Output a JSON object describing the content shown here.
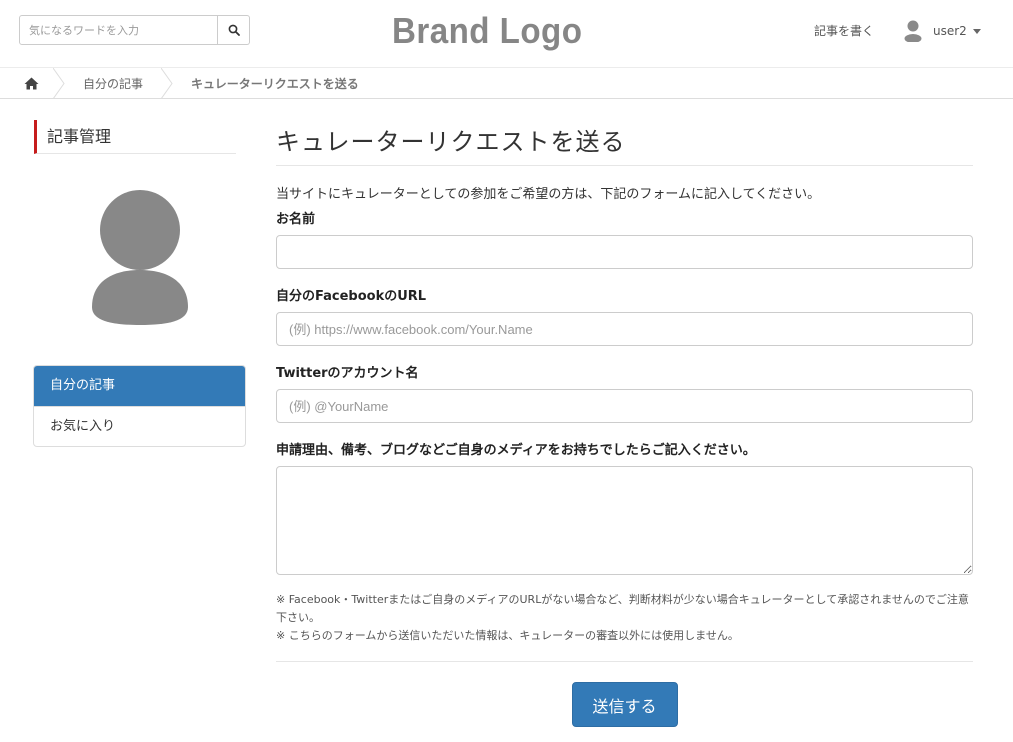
{
  "header": {
    "search_placeholder": "気になるワードを入力",
    "logo_text": "Brand Logo",
    "write_label": "記事を書く",
    "user_name": "user2"
  },
  "breadcrumb": {
    "items": [
      "自分の記事",
      "キュレーターリクエストを送る"
    ]
  },
  "sidebar": {
    "title": "記事管理",
    "menu": [
      {
        "label": "自分の記事",
        "active": true
      },
      {
        "label": "お気に入り",
        "active": false
      }
    ]
  },
  "main": {
    "title": "キュレーターリクエストを送る",
    "intro": "当サイトにキュレーターとしての参加をご希望の方は、下記のフォームに記入してください。",
    "fields": {
      "name_label": "お名前",
      "name_value": "",
      "facebook_label": "自分のFacebookのURL",
      "facebook_placeholder": "(例) https://www.facebook.com/Your.Name",
      "twitter_label": "Twitterのアカウント名",
      "twitter_placeholder": "(例) @YourName",
      "reason_label": "申請理由、備考、ブログなどご自身のメディアをお持ちでしたらご記入ください。",
      "reason_value": ""
    },
    "notes": [
      "※ Facebook・Twitterまたはご自身のメディアのURLがない場合など、判断材料が少ない場合キュレーターとして承認されませんのでご注意下さい。",
      "※ こちらのフォームから送信いただいた情報は、キュレーターの審査以外には使用しません。"
    ],
    "submit_label": "送信する"
  },
  "colors": {
    "primary": "#337ab7",
    "accent_red": "#c61c1c",
    "logo_gray": "#868686"
  }
}
